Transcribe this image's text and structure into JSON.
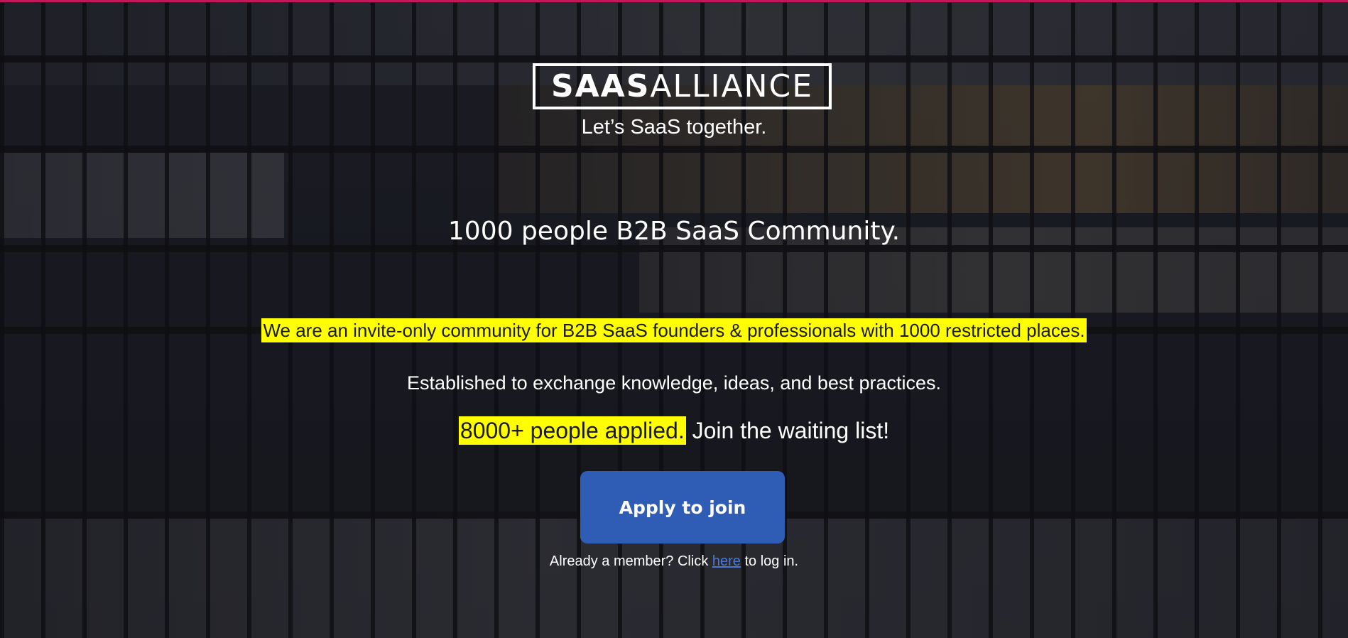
{
  "brand": {
    "logo_bold": "SAAS",
    "logo_light": "ALLIANCE",
    "tagline": "Let’s SaaS together."
  },
  "hero": {
    "headline": "1000 people B2B SaaS Community.",
    "invite_text": "We are an invite-only community for B2B SaaS founders & professionals with 1000 restricted places.",
    "purpose_text": "Established to exchange knowledge, ideas, and best practices.",
    "applied_text": "8000+ people applied.",
    "waitlist_text": "Join the waiting list!",
    "cta_label": "Apply to join"
  },
  "login": {
    "prefix": "Already a member? Click",
    "link_text": "here",
    "suffix": "to log in."
  },
  "colors": {
    "accent_bar": "#c2185b",
    "highlight": "#ffff00",
    "button": "#2f5db5",
    "link": "#4a78d6"
  }
}
